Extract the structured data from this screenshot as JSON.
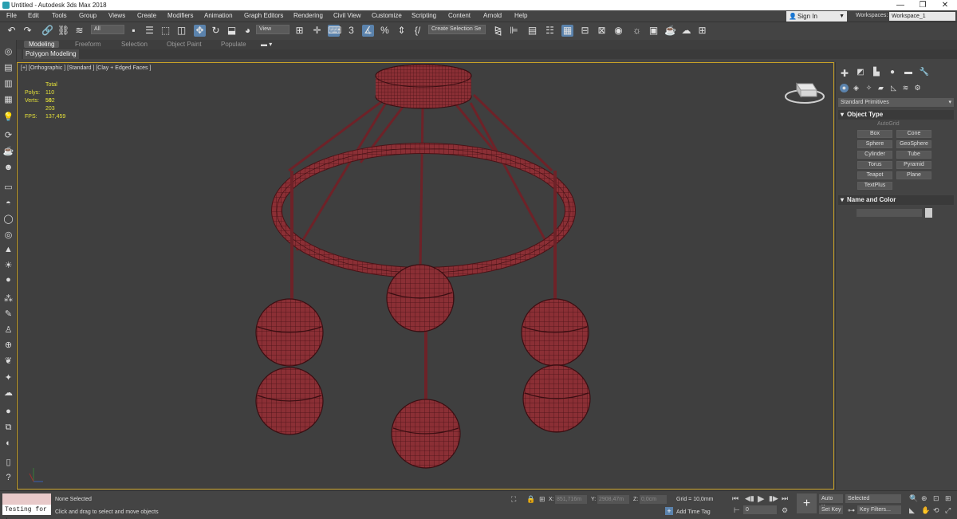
{
  "window": {
    "title": "Untitled - Autodesk 3ds Max 2018",
    "minimize": "—",
    "maximize": "❐",
    "close": "✕"
  },
  "menu": [
    "File",
    "Edit",
    "Tools",
    "Group",
    "Views",
    "Create",
    "Modifiers",
    "Animation",
    "Graph Editors",
    "Rendering",
    "Civil View",
    "Customize",
    "Scripting",
    "Content",
    "Arnold",
    "Help"
  ],
  "account": {
    "sign_in": "Sign In",
    "workspaces_label": "Workspaces:",
    "workspace": "Workspace_1"
  },
  "toolbar": {
    "selection_filter": "All",
    "ref_coord": "View",
    "named_selection": "Create Selection Se"
  },
  "ribbon": {
    "tabs": [
      "Modeling",
      "Freeform",
      "Selection",
      "Object Paint",
      "Populate"
    ],
    "panel": "Polygon Modeling"
  },
  "viewport": {
    "label": "[+] [Orthographic ] [Standard ] [Clay + Edged Faces ]",
    "stats": {
      "total": "Total",
      "polys_label": "Polys:",
      "polys": "110 592",
      "verts_label": "Verts:",
      "verts": "56 203",
      "fps_label": "FPS:",
      "fps": "137,459"
    }
  },
  "command_panel": {
    "category": "Standard Primitives",
    "object_type": "Object Type",
    "autogrid": "AutoGrid",
    "buttons": [
      "Box",
      "Cone",
      "Sphere",
      "GeoSphere",
      "Cylinder",
      "Tube",
      "Torus",
      "Pyramid",
      "Teapot",
      "Plane",
      "TextPlus"
    ],
    "name_color": "Name and Color"
  },
  "status": {
    "maxscript": "Testing for :",
    "selection": "None Selected",
    "prompt": "Click and drag to select and move objects",
    "x_label": "X:",
    "x": "851,716m",
    "y_label": "Y:",
    "y": "2908,47m",
    "z_label": "Z:",
    "z": "0,0cm",
    "grid": "Grid = 10,0mm",
    "add_time_tag": "Add Time Tag",
    "auto_key": "Auto Key",
    "set_key": "Set Key",
    "key_mode": "Selected",
    "key_filters": "Key Filters...",
    "frame": "0"
  },
  "colors": {
    "accent": "#5b83ad",
    "viewport_border": "#c9a227",
    "mesh": "#8b2f35",
    "stats": "#e5e13a"
  }
}
